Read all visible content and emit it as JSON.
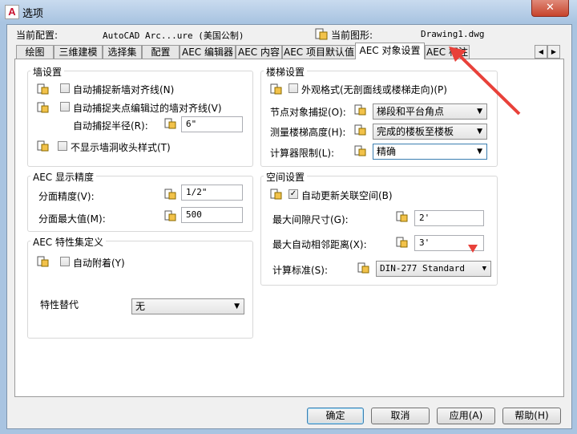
{
  "window": {
    "title": "选项",
    "app_icon": "A",
    "close": "✕"
  },
  "header": {
    "profile_label": "当前配置:",
    "profile_value": "AutoCAD Arc...ure (美国公制)",
    "drawing_label": "当前图形:",
    "drawing_value": "Drawing1.dwg"
  },
  "tabs": [
    "绘图",
    "三维建模",
    "选择集",
    "配置",
    "AEC 编辑器",
    "AEC 内容",
    "AEC 项目默认值",
    "AEC 对象设置",
    "AEC 标注"
  ],
  "active_tab": "AEC 对象设置",
  "tab_scroll": {
    "left": "◀",
    "right": "▶"
  },
  "wall": {
    "title": "墙设置",
    "autosnap_new": "自动捕捉新墙对齐线(N)",
    "autosnap_grip": "自动捕捉夹点编辑过的墙对齐线(V)",
    "radius_label": "自动捕捉半径(R):",
    "radius_value": "6\"",
    "no_cleanup": "不显示墙洞收头样式(T)"
  },
  "precision": {
    "title": "AEC 显示精度",
    "area_precision_label": "分面精度(V):",
    "area_precision_value": "1/2\"",
    "area_max_label": "分面最大值(M):",
    "area_max_value": "500"
  },
  "property": {
    "title": "AEC 特性集定义",
    "auto_attach": "自动附着(Y)",
    "override_label": "特性替代",
    "override_value": "无"
  },
  "stair": {
    "title": "楼梯设置",
    "outline": "外观格式(无剖面线或楼梯走向)(P)",
    "node_snap_label": "节点对象捕捉(O):",
    "node_snap_value": "梯段和平台角点",
    "measure_label": "测量楼梯高度(H):",
    "measure_value": "完成的楼板至楼板",
    "calc_label": "计算器限制(L):",
    "calc_value": "精确"
  },
  "space": {
    "title": "空间设置",
    "auto_update": "自动更新关联空间(B)",
    "auto_update_checked": true,
    "gap_label": "最大间隙尺寸(G):",
    "gap_value": "2'",
    "adjacency_label": "最大自动相邻距离(X):",
    "adjacency_value": "3'",
    "standard_label": "计算标准(S):",
    "standard_value": "DIN-277 Standard"
  },
  "buttons": {
    "ok": "确定",
    "cancel": "取消",
    "apply": "应用(A)",
    "help": "帮助(H)"
  },
  "colors": {
    "annotation_red": "#e8413a",
    "title_bar": "#a9c4e1",
    "close_button": "#c7432b"
  }
}
